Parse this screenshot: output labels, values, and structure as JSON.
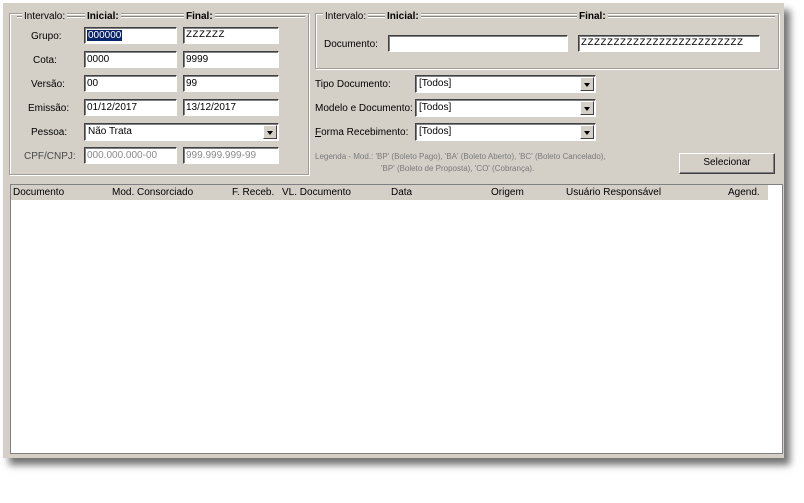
{
  "filters_left": {
    "interval_label": "Intervalo:",
    "initial_label": "Inicial:",
    "final_label": "Final:",
    "rows": [
      {
        "label": "Grupo:",
        "initial": "000000",
        "final": "ZZZZZZ"
      },
      {
        "label": "Cota:",
        "initial": "0000",
        "final": "9999"
      },
      {
        "label": "Versão:",
        "initial": "00",
        "final": "99"
      },
      {
        "label": "Emissão:",
        "initial": "01/12/2017",
        "final": "13/12/2017"
      }
    ],
    "pessoa": {
      "label": "Pessoa:",
      "value": "Não Trata"
    },
    "cpf": {
      "label": "CPF/CNPJ:",
      "initial": "000.000.000-00",
      "final": "999.999.999-99"
    }
  },
  "filters_right": {
    "interval_label": "Intervalo:",
    "initial_label": "Inicial:",
    "final_label": "Final:",
    "documento": {
      "label": "Documento:",
      "initial": "",
      "final": "ZZZZZZZZZZZZZZZZZZZZZZZZZ"
    }
  },
  "combos": {
    "tipo_documento": {
      "label": "Tipo Documento:",
      "value": "[Todos]"
    },
    "modelo_documento": {
      "label": "Modelo e Documento:",
      "value": "[Todos]"
    },
    "forma_recebimento": {
      "label_accel": "F",
      "label_rest": "orma Recebimento:",
      "value": "[Todos]"
    }
  },
  "legend": {
    "line1": "Legenda - Mod.: 'BP' (Boleto Pago), 'BA' (Boleto Aberto), 'BC' (Boleto Cancelado),",
    "line2": "'BP' (Boleto de Proposta), 'CO' (Cobrança)."
  },
  "buttons": {
    "select": "Selecionar"
  },
  "grid": {
    "columns": [
      "Documento",
      "Mod. Consorciado",
      "F. Receb.",
      "VL. Documento",
      "Data",
      "Origem",
      "Usuário Responsável",
      "Agend."
    ],
    "rows": []
  }
}
